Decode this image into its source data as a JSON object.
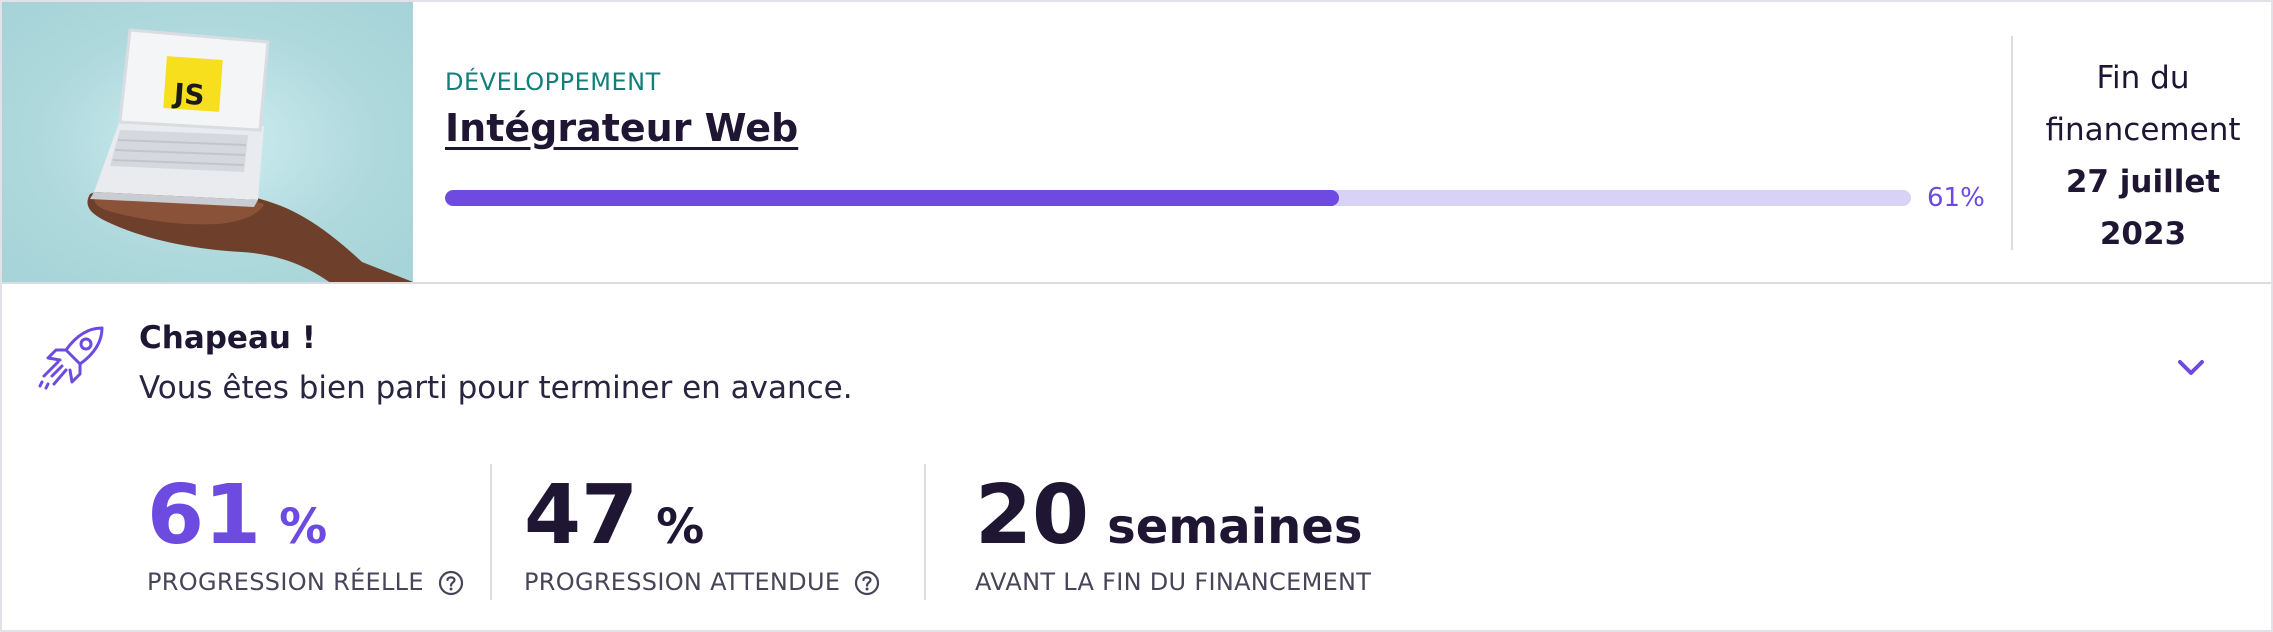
{
  "course": {
    "category": "DÉVELOPPEMENT",
    "title": "Intégrateur Web",
    "progress_percent": 61,
    "progress_label": "61%",
    "thumbnail_badge": "JS"
  },
  "funding": {
    "line1": "Fin du",
    "line2": "financement",
    "date": "27 juillet 2023"
  },
  "feedback": {
    "headline": "Chapeau !",
    "message": "Vous êtes bien parti pour terminer en avance."
  },
  "stats": [
    {
      "value": "61",
      "unit": "%",
      "label": "PROGRESSION RÉELLE",
      "color": "#6d4ae0"
    },
    {
      "value": "47",
      "unit": "%",
      "label": "PROGRESSION ATTENDUE",
      "color": "#1f1634"
    },
    {
      "value": "20",
      "unit": "semaines",
      "label": "AVANT LA FIN DU FINANCEMENT",
      "color": "#1f1634"
    }
  ],
  "colors": {
    "accent": "#6d4ae0",
    "accent_light": "#d9d2f7",
    "category": "#12807a",
    "text": "#1f1634",
    "thumbnail_bg": "#a5d3d7",
    "js_badge": "#f7df1e"
  },
  "icons": {
    "rocket": "rocket-icon",
    "chevron": "chevron-down-icon",
    "help": "question-circle-icon",
    "thumbnail": "laptop-on-hand-illustration"
  }
}
